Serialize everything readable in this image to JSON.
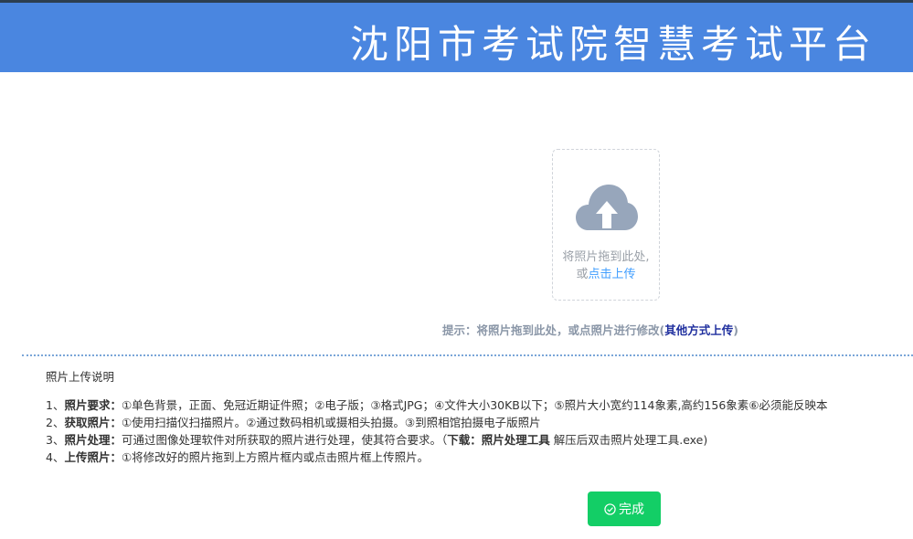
{
  "header": {
    "title": "沈阳市考试院智慧考试平台"
  },
  "upload": {
    "drop_text_line1": "将照片拖到此处,",
    "drop_text_prefix": "或",
    "click_upload_link": "点击上传"
  },
  "hint": {
    "text": "提示：将照片拖到此处，或点照片进行修改(",
    "other_link": "其他方式上传",
    "close": ")"
  },
  "notes": {
    "title": "照片上传说明",
    "items": [
      {
        "prefix": "1、",
        "label": "照片要求：",
        "text": "①单色背景，正面、免冠近期证件照；②电子版；③格式JPG；④文件大小30KB以下；⑤照片大小宽约114象素,高约156象素⑥必须能反映本"
      },
      {
        "prefix": "2、",
        "label": "获取照片：",
        "text": "①使用扫描仪扫描照片。②通过数码相机或摄相头拍摄。③到照相馆拍摄电子版照片"
      },
      {
        "prefix": "3、",
        "label": "照片处理：",
        "text": "可通过图像处理软件对所获取的照片进行处理，使其符合要求。（",
        "download_label": "下载：照片处理工具",
        "text2": " 解压后双击照片处理工具.exe)"
      },
      {
        "prefix": "4、",
        "label": "上传照片：",
        "text": "①将修改好的照片拖到上方照片框内或点击照片框上传照片。"
      }
    ]
  },
  "finish_button": {
    "label": "完成"
  },
  "icons": {
    "upload": "cloud-upload-icon",
    "finish": "check-circle-icon"
  },
  "colors": {
    "header": "#4a86e0",
    "finish": "#13ce66",
    "link": "#409eff"
  }
}
